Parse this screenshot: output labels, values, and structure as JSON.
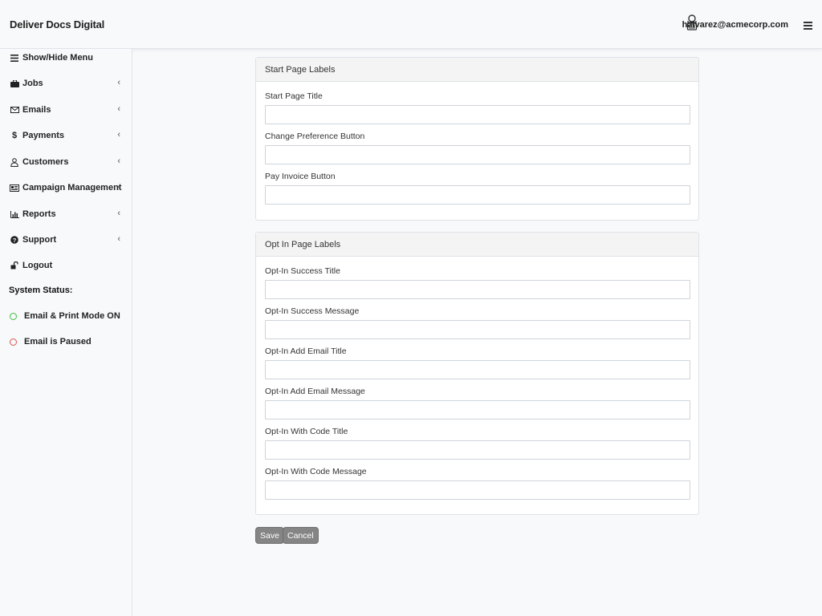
{
  "app": {
    "brand": "Deliver Docs Digital",
    "user_email": "halvarez@acmecorp.com"
  },
  "colors": {
    "status_on": "#3dbf3d",
    "status_paused": "#d9534f",
    "button_bg": "#858585"
  },
  "sidebar": {
    "items": [
      {
        "label": "Show/Hide Menu",
        "icon": "menu-icon"
      },
      {
        "label": "Jobs",
        "icon": "briefcase-icon",
        "expandable": true
      },
      {
        "label": "Emails",
        "icon": "envelope-icon",
        "expandable": true
      },
      {
        "label": "Payments",
        "icon": "dollar-icon",
        "expandable": true
      },
      {
        "label": "Customers",
        "icon": "user-icon",
        "expandable": true
      },
      {
        "label": "Campaign Management",
        "icon": "newspaper-icon",
        "expandable": true
      },
      {
        "label": "Reports",
        "icon": "bar-chart-icon",
        "expandable": true
      },
      {
        "label": "Support",
        "icon": "question-circle-icon",
        "expandable": true
      },
      {
        "label": "Logout",
        "icon": "unlock-icon"
      }
    ],
    "system_status": {
      "heading": "System Status:",
      "items": [
        {
          "label": "Email & Print Mode ON",
          "state": "on"
        },
        {
          "label": "Email is Paused",
          "state": "paused"
        }
      ]
    }
  },
  "start_page": {
    "header": "Start Page Labels",
    "fields": [
      {
        "label": "Start Page Title",
        "value": ""
      },
      {
        "label": "Change Preference Button",
        "value": ""
      },
      {
        "label": "Pay Invoice Button",
        "value": ""
      }
    ]
  },
  "opt_in_page": {
    "header": "Opt In Page Labels",
    "fields": [
      {
        "label": "Opt-In Success Title",
        "value": ""
      },
      {
        "label": "Opt-In Success Message",
        "value": ""
      },
      {
        "label": "Opt-In Add Email Title",
        "value": ""
      },
      {
        "label": "Opt-In Add Email Message",
        "value": ""
      },
      {
        "label": "Opt-In With Code Title",
        "value": ""
      },
      {
        "label": "Opt-In With Code Message",
        "value": ""
      }
    ]
  },
  "actions": {
    "save": "Save",
    "cancel": "Cancel"
  }
}
